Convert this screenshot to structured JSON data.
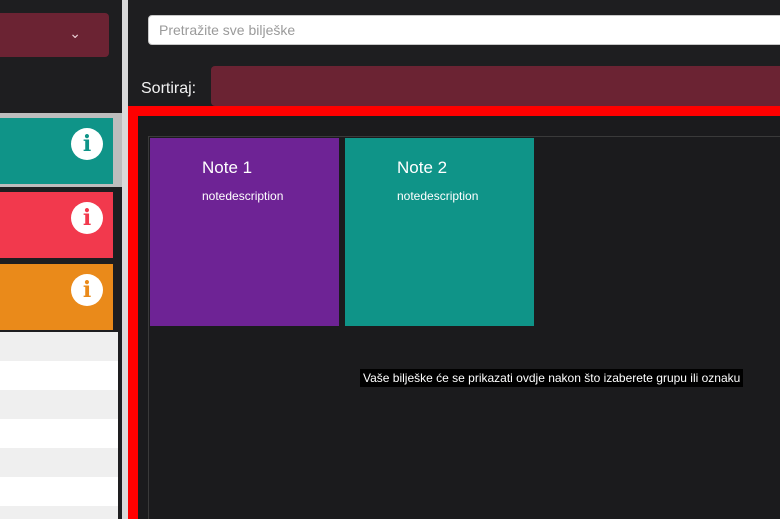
{
  "left_panel": {
    "group_select": {
      "value": "",
      "icon": "chevron-down-icon"
    },
    "tags": [
      {
        "color": "#0f9488",
        "icon": "info-icon"
      },
      {
        "color": "#f2394d",
        "icon": "info-icon"
      },
      {
        "color": "#ea8a1a",
        "icon": "info-icon"
      }
    ]
  },
  "search": {
    "placeholder": "Pretražite sve bilješke",
    "value": ""
  },
  "sort": {
    "label": "Sortiraj:",
    "value": ""
  },
  "notes": [
    {
      "title": "Note 1",
      "description": "notedescription",
      "color": "#6e2395"
    },
    {
      "title": "Note 2",
      "description": "notedescription",
      "color": "#0f9488"
    }
  ],
  "empty_message": "Vaše bilješke će se prikazati ovdje nakon što izaberete grupu ili oznaku",
  "colors": {
    "accent": "#6b2333",
    "highlight_border": "#ff0000",
    "background": "#1e1e20"
  }
}
